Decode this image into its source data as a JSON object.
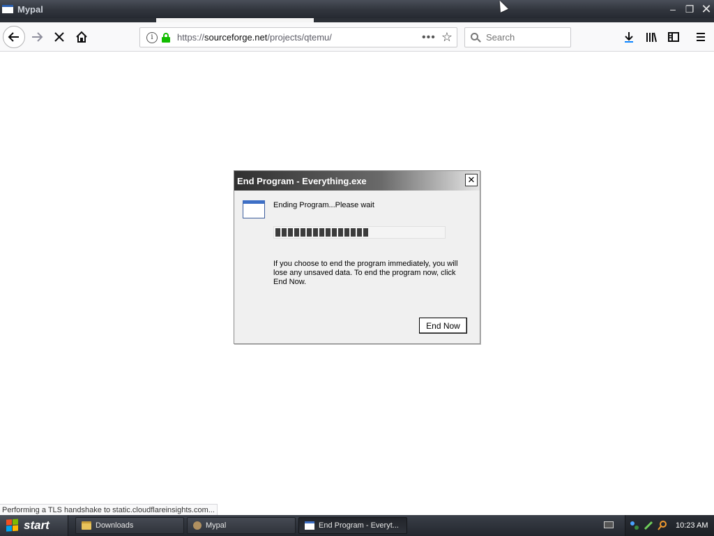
{
  "window": {
    "title": "Mypal"
  },
  "navbar": {
    "url_scheme": "https://",
    "url_domain": "sourceforge.net",
    "url_path": "/projects/qtemu/",
    "url_more": "•••",
    "search_placeholder": "Search"
  },
  "dialog": {
    "title": "End Program - Everything.exe",
    "close_label": "✕",
    "status": "Ending Program...Please wait",
    "progress_percent": 55,
    "message": "If you choose to end the program immediately, you will lose any unsaved data. To end the program now, click End Now.",
    "end_now_label": "End Now"
  },
  "statusbar": {
    "text": "Performing a TLS handshake to static.cloudflareinsights.com..."
  },
  "taskbar": {
    "start_label": "start",
    "tasks": [
      {
        "label": "Downloads"
      },
      {
        "label": "Mypal"
      },
      {
        "label": "End Program - Everyt..."
      }
    ],
    "clock": "10:23 AM"
  }
}
